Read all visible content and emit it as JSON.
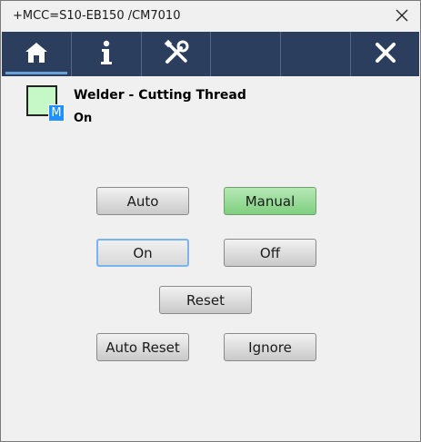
{
  "window": {
    "title": "+MCC=S10-EB150 /CM7010"
  },
  "toolbar": {
    "buttons": [
      {
        "icon": "home-icon",
        "active": true
      },
      {
        "icon": "info-icon",
        "active": false
      },
      {
        "icon": "tools-icon",
        "active": false
      },
      {
        "icon": "empty",
        "active": false
      },
      {
        "icon": "empty",
        "active": false
      },
      {
        "icon": "close-icon",
        "active": false
      }
    ]
  },
  "status": {
    "device_name": "Welder - Cutting Thread",
    "state": "On",
    "mode_badge": "M",
    "indicator_color": "#c6f7c6"
  },
  "controls": {
    "auto": "Auto",
    "manual": "Manual",
    "on": "On",
    "off": "Off",
    "reset": "Reset",
    "auto_reset": "Auto Reset",
    "ignore": "Ignore"
  },
  "colors": {
    "toolbar_bg": "#2c3e5e",
    "active_green": "#8fd68f",
    "focus_blue": "#78b4f0"
  }
}
